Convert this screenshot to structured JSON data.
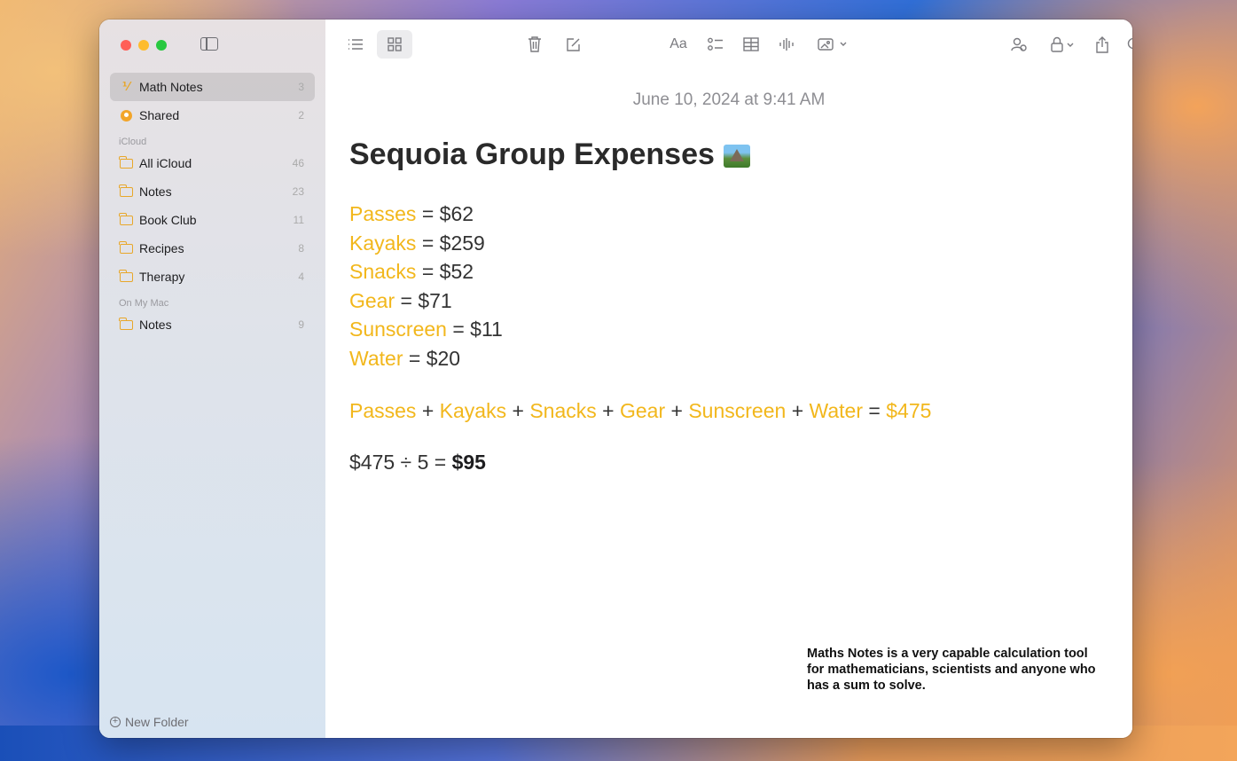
{
  "sidebar": {
    "pinned": [
      {
        "label": "Math Notes",
        "count": "3",
        "icon": "math-icon"
      },
      {
        "label": "Shared",
        "count": "2",
        "icon": "shared-icon"
      }
    ],
    "icloud_label": "iCloud",
    "icloud": [
      {
        "label": "All iCloud",
        "count": "46"
      },
      {
        "label": "Notes",
        "count": "23"
      },
      {
        "label": "Book Club",
        "count": "11"
      },
      {
        "label": "Recipes",
        "count": "8"
      },
      {
        "label": "Therapy",
        "count": "4"
      }
    ],
    "onmymac_label": "On My Mac",
    "onmymac": [
      {
        "label": "Notes",
        "count": "9"
      }
    ],
    "new_folder": "New Folder"
  },
  "toolbar": {
    "icons": [
      "list-view-icon",
      "gallery-view-icon",
      "trash-icon",
      "compose-icon",
      "format-icon",
      "checklist-icon",
      "table-icon",
      "audio-icon",
      "media-icon",
      "collaborate-icon",
      "lock-icon",
      "share-icon",
      "search-icon"
    ],
    "format_label": "Aa"
  },
  "note": {
    "date": "June 10, 2024 at 9:41 AM",
    "title": "Sequoia Group Expenses",
    "variables": [
      {
        "name": "Passes",
        "value": "= $62"
      },
      {
        "name": "Kayaks",
        "value": "= $259"
      },
      {
        "name": "Snacks",
        "value": "= $52"
      },
      {
        "name": "Gear",
        "value": "= $71"
      },
      {
        "name": "Sunscreen",
        "value": "= $11"
      },
      {
        "name": "Water",
        "value": "= $20"
      }
    ],
    "sum_terms": [
      "Passes",
      "Kayaks",
      "Snacks",
      "Gear",
      "Sunscreen",
      "Water"
    ],
    "sum_plus": "+",
    "sum_equals": "=",
    "sum_result": "$475",
    "division_expr": "$475 ÷ 5 =",
    "division_result": "$95"
  },
  "caption": "Maths Notes is a very capable calculation tool for mathematicians, scientists and anyone who has a sum to solve.",
  "colors": {
    "accent": "#f2b71c",
    "folder": "#e8a72a"
  }
}
